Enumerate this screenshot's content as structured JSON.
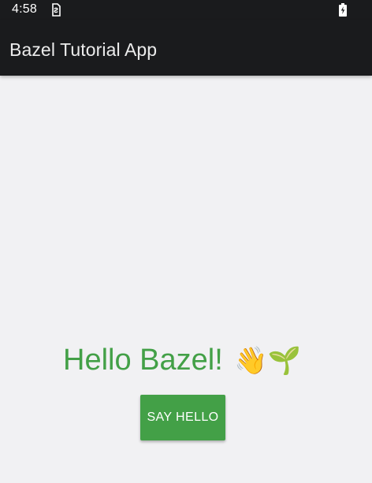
{
  "status_bar": {
    "time": "4:58",
    "sim_icon": "sim-card-icon",
    "battery_icon": "battery-charging-icon"
  },
  "app_bar": {
    "title": "Bazel Tutorial App",
    "background": "#1a1b1d"
  },
  "main": {
    "greeting_text": "Hello Bazel!",
    "greeting_emoji": "👋🌱",
    "button_label": "SAY HELLO",
    "accent_color": "#43a047"
  }
}
